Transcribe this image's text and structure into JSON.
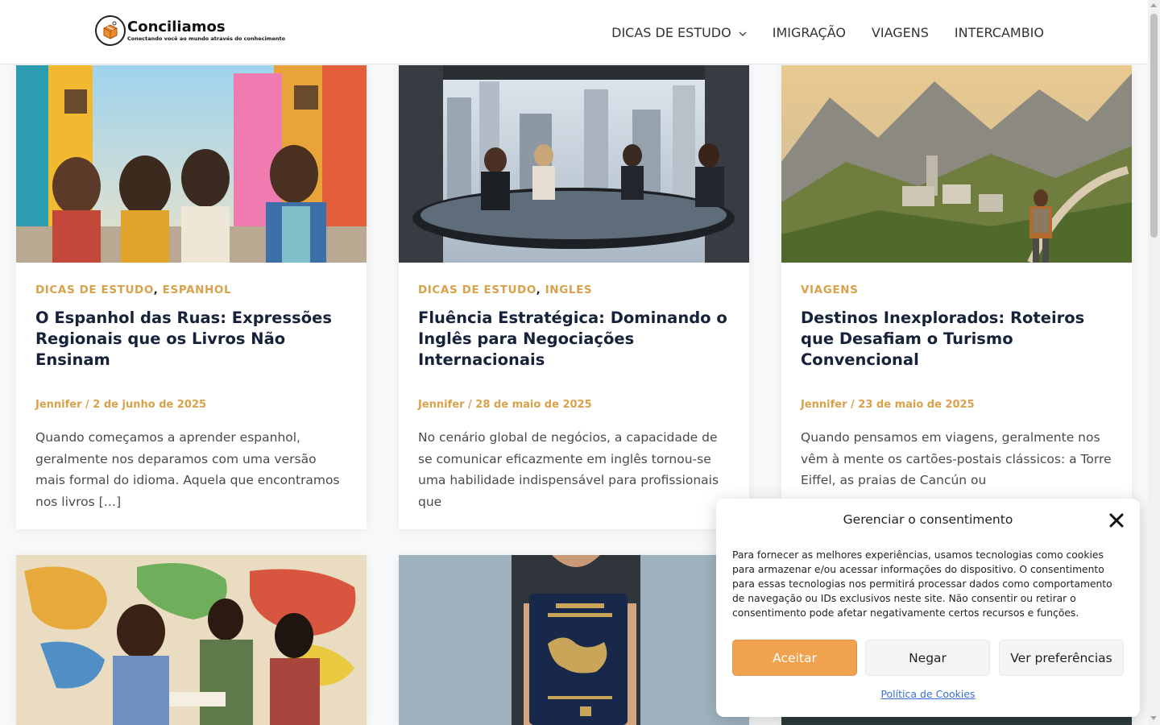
{
  "site": {
    "name": "Conciliamos",
    "tagline": "Conectando você ao mundo através do conhecimento"
  },
  "nav": {
    "items": [
      {
        "label": "DICAS DE ESTUDO",
        "has_dropdown": true
      },
      {
        "label": "IMIGRAÇÃO"
      },
      {
        "label": "VIAGENS"
      },
      {
        "label": "INTERCAMBIO"
      }
    ]
  },
  "posts": [
    {
      "categories": [
        "DICAS DE ESTUDO",
        "ESPANHOL"
      ],
      "title": "O Espanhol das Ruas: Expressões Regionais que os Livros Não Ensinam",
      "meta": "Jennifer / 2 de junho de 2025",
      "excerpt": "Quando começamos a aprender espanhol, geralmente nos deparamos com uma versão mais formal do idioma. Aquela que encontramos nos livros […]"
    },
    {
      "categories": [
        "DICAS DE ESTUDO",
        "INGLES"
      ],
      "title": "Fluência Estratégica: Dominando o Inglês para Negociações Internacionais",
      "meta": "Jennifer / 28 de maio de 2025",
      "excerpt": "No cenário global de negócios, a capacidade de se comunicar eficazmente em inglês tornou-se uma habilidade indispensável para profissionais que"
    },
    {
      "categories": [
        "VIAGENS"
      ],
      "title": "Destinos Inexplorados: Roteiros que Desafiam o Turismo Convencional",
      "meta": "Jennifer / 23 de maio de 2025",
      "excerpt": "Quando pensamos em viagens, geralmente nos vêm à mente os cartões-postais clássicos: a Torre Eiffel, as praias de Cancún ou"
    }
  ],
  "consent": {
    "title": "Gerenciar o consentimento",
    "text": "Para fornecer as melhores experiências, usamos tecnologias como cookies para armazenar e/ou acessar informações do dispositivo. O consentimento para essas tecnologias nos permitirá processar dados como comportamento de navegação ou IDs exclusivos neste site. Não consentir ou retirar o consentimento pode afetar negativamente certos recursos e funções.",
    "accept_label": "Aceitar",
    "deny_label": "Negar",
    "preferences_label": "Ver preferências",
    "policy_link": "Política de Cookies"
  },
  "colors": {
    "accent": "#d9a14a",
    "accept_button": "#f0a24e",
    "title": "#16213a",
    "link": "#3b6fd1"
  },
  "icons": [
    "logo-box-icon",
    "chevron-down-icon",
    "close-icon"
  ]
}
